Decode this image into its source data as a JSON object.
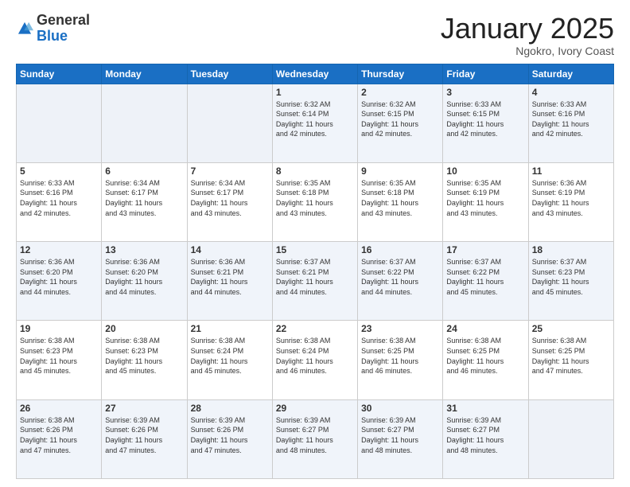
{
  "header": {
    "logo_general": "General",
    "logo_blue": "Blue",
    "month_title": "January 2025",
    "location": "Ngokro, Ivory Coast"
  },
  "calendar": {
    "days_of_week": [
      "Sunday",
      "Monday",
      "Tuesday",
      "Wednesday",
      "Thursday",
      "Friday",
      "Saturday"
    ],
    "weeks": [
      [
        {
          "day": "",
          "info": ""
        },
        {
          "day": "",
          "info": ""
        },
        {
          "day": "",
          "info": ""
        },
        {
          "day": "1",
          "info": "Sunrise: 6:32 AM\nSunset: 6:14 PM\nDaylight: 11 hours\nand 42 minutes."
        },
        {
          "day": "2",
          "info": "Sunrise: 6:32 AM\nSunset: 6:15 PM\nDaylight: 11 hours\nand 42 minutes."
        },
        {
          "day": "3",
          "info": "Sunrise: 6:33 AM\nSunset: 6:15 PM\nDaylight: 11 hours\nand 42 minutes."
        },
        {
          "day": "4",
          "info": "Sunrise: 6:33 AM\nSunset: 6:16 PM\nDaylight: 11 hours\nand 42 minutes."
        }
      ],
      [
        {
          "day": "5",
          "info": "Sunrise: 6:33 AM\nSunset: 6:16 PM\nDaylight: 11 hours\nand 42 minutes."
        },
        {
          "day": "6",
          "info": "Sunrise: 6:34 AM\nSunset: 6:17 PM\nDaylight: 11 hours\nand 43 minutes."
        },
        {
          "day": "7",
          "info": "Sunrise: 6:34 AM\nSunset: 6:17 PM\nDaylight: 11 hours\nand 43 minutes."
        },
        {
          "day": "8",
          "info": "Sunrise: 6:35 AM\nSunset: 6:18 PM\nDaylight: 11 hours\nand 43 minutes."
        },
        {
          "day": "9",
          "info": "Sunrise: 6:35 AM\nSunset: 6:18 PM\nDaylight: 11 hours\nand 43 minutes."
        },
        {
          "day": "10",
          "info": "Sunrise: 6:35 AM\nSunset: 6:19 PM\nDaylight: 11 hours\nand 43 minutes."
        },
        {
          "day": "11",
          "info": "Sunrise: 6:36 AM\nSunset: 6:19 PM\nDaylight: 11 hours\nand 43 minutes."
        }
      ],
      [
        {
          "day": "12",
          "info": "Sunrise: 6:36 AM\nSunset: 6:20 PM\nDaylight: 11 hours\nand 44 minutes."
        },
        {
          "day": "13",
          "info": "Sunrise: 6:36 AM\nSunset: 6:20 PM\nDaylight: 11 hours\nand 44 minutes."
        },
        {
          "day": "14",
          "info": "Sunrise: 6:36 AM\nSunset: 6:21 PM\nDaylight: 11 hours\nand 44 minutes."
        },
        {
          "day": "15",
          "info": "Sunrise: 6:37 AM\nSunset: 6:21 PM\nDaylight: 11 hours\nand 44 minutes."
        },
        {
          "day": "16",
          "info": "Sunrise: 6:37 AM\nSunset: 6:22 PM\nDaylight: 11 hours\nand 44 minutes."
        },
        {
          "day": "17",
          "info": "Sunrise: 6:37 AM\nSunset: 6:22 PM\nDaylight: 11 hours\nand 45 minutes."
        },
        {
          "day": "18",
          "info": "Sunrise: 6:37 AM\nSunset: 6:23 PM\nDaylight: 11 hours\nand 45 minutes."
        }
      ],
      [
        {
          "day": "19",
          "info": "Sunrise: 6:38 AM\nSunset: 6:23 PM\nDaylight: 11 hours\nand 45 minutes."
        },
        {
          "day": "20",
          "info": "Sunrise: 6:38 AM\nSunset: 6:23 PM\nDaylight: 11 hours\nand 45 minutes."
        },
        {
          "day": "21",
          "info": "Sunrise: 6:38 AM\nSunset: 6:24 PM\nDaylight: 11 hours\nand 45 minutes."
        },
        {
          "day": "22",
          "info": "Sunrise: 6:38 AM\nSunset: 6:24 PM\nDaylight: 11 hours\nand 46 minutes."
        },
        {
          "day": "23",
          "info": "Sunrise: 6:38 AM\nSunset: 6:25 PM\nDaylight: 11 hours\nand 46 minutes."
        },
        {
          "day": "24",
          "info": "Sunrise: 6:38 AM\nSunset: 6:25 PM\nDaylight: 11 hours\nand 46 minutes."
        },
        {
          "day": "25",
          "info": "Sunrise: 6:38 AM\nSunset: 6:25 PM\nDaylight: 11 hours\nand 47 minutes."
        }
      ],
      [
        {
          "day": "26",
          "info": "Sunrise: 6:38 AM\nSunset: 6:26 PM\nDaylight: 11 hours\nand 47 minutes."
        },
        {
          "day": "27",
          "info": "Sunrise: 6:39 AM\nSunset: 6:26 PM\nDaylight: 11 hours\nand 47 minutes."
        },
        {
          "day": "28",
          "info": "Sunrise: 6:39 AM\nSunset: 6:26 PM\nDaylight: 11 hours\nand 47 minutes."
        },
        {
          "day": "29",
          "info": "Sunrise: 6:39 AM\nSunset: 6:27 PM\nDaylight: 11 hours\nand 48 minutes."
        },
        {
          "day": "30",
          "info": "Sunrise: 6:39 AM\nSunset: 6:27 PM\nDaylight: 11 hours\nand 48 minutes."
        },
        {
          "day": "31",
          "info": "Sunrise: 6:39 AM\nSunset: 6:27 PM\nDaylight: 11 hours\nand 48 minutes."
        },
        {
          "day": "",
          "info": ""
        }
      ]
    ]
  }
}
